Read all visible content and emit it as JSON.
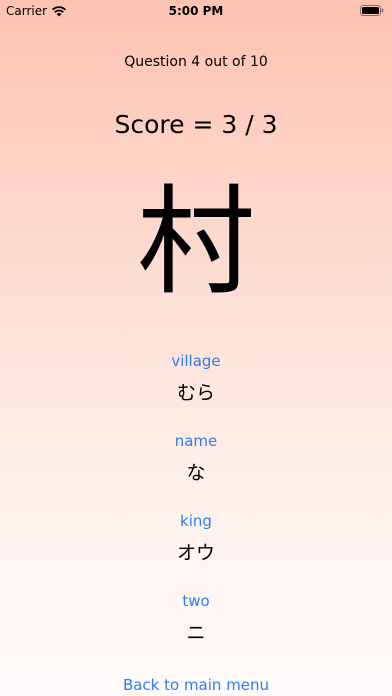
{
  "status_bar": {
    "carrier": "Carrier",
    "time": "5:00 PM"
  },
  "quiz": {
    "question_text": "Question 4 out of 10",
    "score_text": "Score = 3 / 3",
    "kanji": "村",
    "choices": [
      {
        "meaning": "village",
        "reading": "むら"
      },
      {
        "meaning": "name",
        "reading": "な"
      },
      {
        "meaning": "king",
        "reading": "オウ"
      },
      {
        "meaning": "two",
        "reading": "ニ"
      }
    ]
  },
  "navigation": {
    "back_label": "Back to main menu"
  },
  "colors": {
    "accent": "#2a7ef4",
    "gradient_top": "#fdc3b2",
    "gradient_bottom": "#fffafa"
  }
}
